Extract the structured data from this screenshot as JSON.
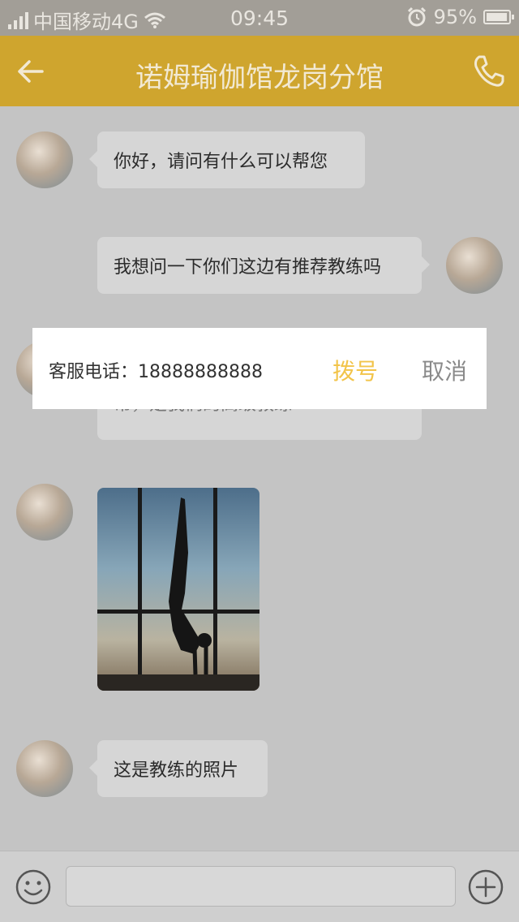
{
  "status_bar": {
    "carrier": "中国移动4G",
    "time": "09:45",
    "battery": "95%"
  },
  "header": {
    "title": "诺姆瑜伽馆龙岗分馆"
  },
  "messages": [
    {
      "side": "left",
      "text": "你好，请问有什么可以帮您"
    },
    {
      "side": "right",
      "text": "我想问一下你们这边有推荐教练吗"
    },
    {
      "side": "left",
      "text": "帮，是我们的高级教练"
    },
    {
      "side": "left",
      "type": "image"
    },
    {
      "side": "left",
      "text": "这是教练的照片"
    }
  ],
  "dialog": {
    "label": "客服电话：18888888888",
    "dial": "拨号",
    "cancel": "取消"
  },
  "input_bar": {
    "placeholder": ""
  }
}
